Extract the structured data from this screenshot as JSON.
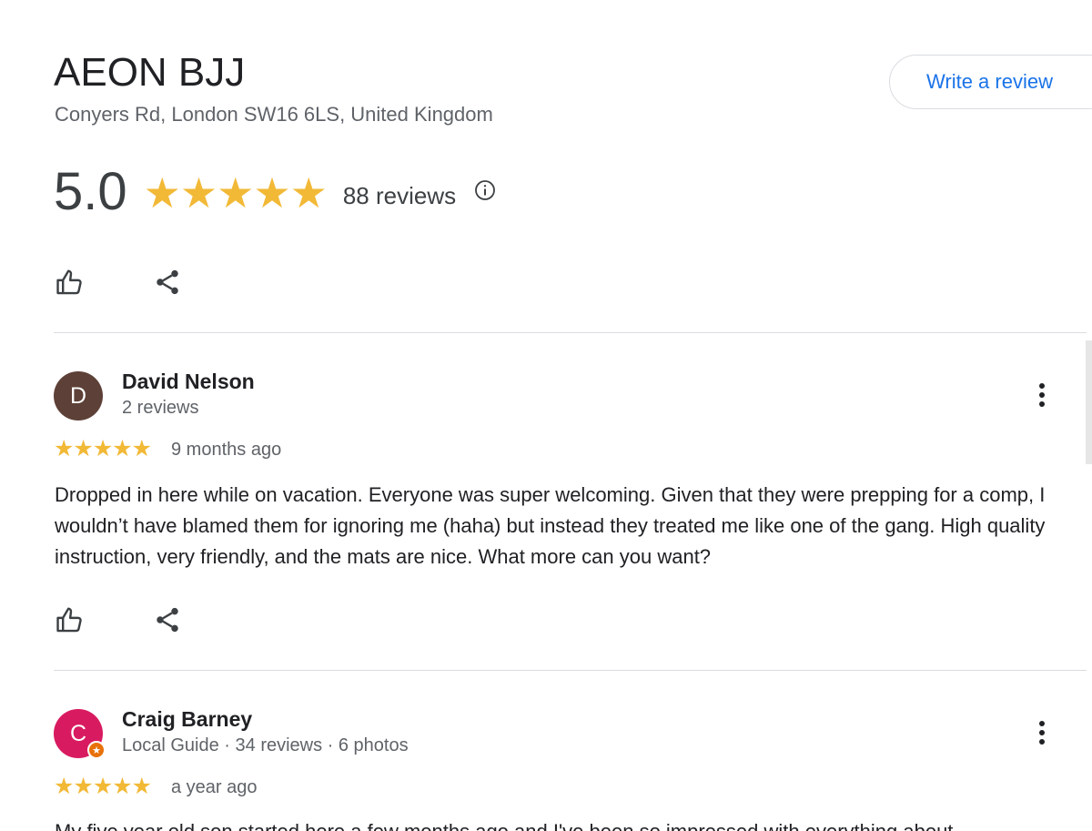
{
  "place": {
    "name": "AEON BJJ",
    "address": "Conyers Rd, London SW16 6LS, United Kingdom"
  },
  "write_review_label": "Write a review",
  "rating": {
    "score": "5.0",
    "stars": "★★★★★",
    "stars_value": 5,
    "review_count": "88 reviews"
  },
  "reviews": [
    {
      "avatar_letter": "D",
      "avatar_color": "#5d4037",
      "name": "David Nelson",
      "meta": "2 reviews",
      "stars": "★★★★★",
      "stars_value": 5,
      "time": "9 months ago",
      "text": "Dropped in here while on vacation. Everyone was super welcoming. Given that they were prepping for a comp, I wouldn’t have blamed them for ignoring me (haha) but instead they treated me like one of the gang. High quality instruction, very friendly, and the mats are nice. What more can you want?"
    },
    {
      "avatar_letter": "C",
      "avatar_color": "#d81b60",
      "local_guide_badge": "★",
      "name": "Craig Barney",
      "meta": "Local Guide · 34 reviews · 6 photos",
      "stars": "★★★★★",
      "stars_value": 5,
      "time": "a year ago",
      "text": "My five year old son started here a few months ago and I've been so impressed with everything about"
    }
  ],
  "colors": {
    "accent_blue": "#1a73e8",
    "star_yellow": "#f2b937",
    "divider": "#dadce0",
    "secondary_text": "#5f6368"
  },
  "icons": [
    "info-icon",
    "thumbs-up-icon",
    "share-icon",
    "more-vert-icon"
  ]
}
